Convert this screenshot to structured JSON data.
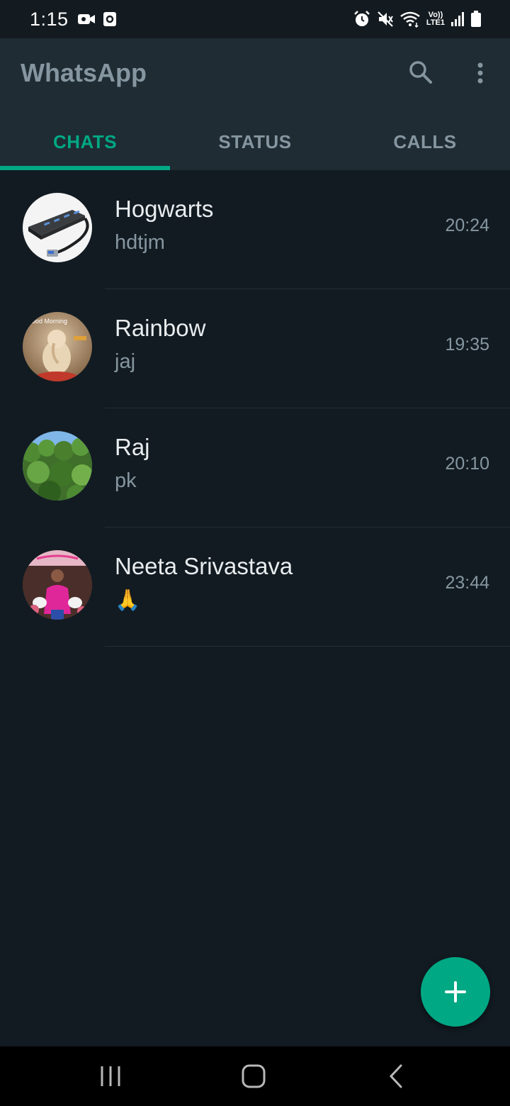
{
  "status_bar": {
    "time": "1:15",
    "left_icons": [
      "video-camera-icon",
      "screenshot-icon"
    ],
    "right_icons": [
      "alarm-icon",
      "mute-icon",
      "wifi-icon",
      "volte-icon",
      "signal-icon",
      "battery-icon"
    ],
    "volte_text_top": "Vo))",
    "volte_text_bottom": "LTE1"
  },
  "app_bar": {
    "title": "WhatsApp",
    "actions": [
      "search-icon",
      "more-vertical-icon"
    ]
  },
  "tabs": [
    {
      "label": "CHATS",
      "active": true
    },
    {
      "label": "STATUS",
      "active": false
    },
    {
      "label": "CALLS",
      "active": false
    }
  ],
  "chats": [
    {
      "name": "Hogwarts",
      "preview": "hdtjm",
      "time": "20:24",
      "avatar": "usb-hub-photo"
    },
    {
      "name": "Rainbow",
      "preview": "jaj",
      "time": "19:35",
      "avatar": "ganesha-good-morning-photo",
      "avatar_text": "Good Morning"
    },
    {
      "name": "Raj",
      "preview": "pk",
      "time": "20:10",
      "avatar": "green-trees-photo"
    },
    {
      "name": "Neeta Srivastava",
      "preview": "🙏",
      "time": "23:44",
      "avatar": "woman-with-cake-photo"
    }
  ],
  "fab": {
    "icon": "plus-icon"
  },
  "colors": {
    "accent": "#00a884",
    "background": "#121b22",
    "app_bar": "#1f2c34",
    "primary_text": "#e9edef",
    "secondary_text": "#8696a0"
  }
}
